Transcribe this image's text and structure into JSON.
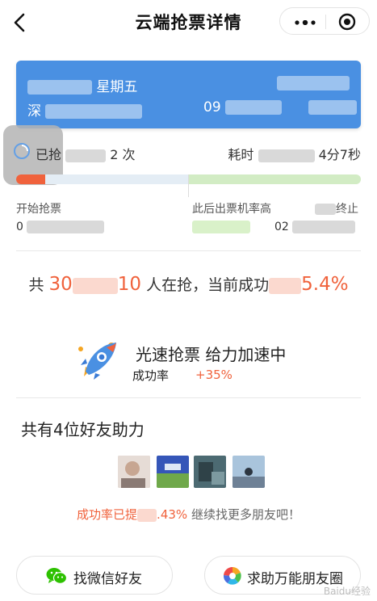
{
  "header": {
    "title": "云端抢票详情",
    "icons": {
      "back": "chevron-left-icon",
      "more": "more-dots-icon",
      "close": "record-circle-icon"
    }
  },
  "ticket": {
    "weekday": "星期五",
    "from_prefix": "深",
    "time_prefix": "09"
  },
  "stats": {
    "grab_prefix": "已抢",
    "grab_suffix": "2 次",
    "elapsed_prefix": "耗时",
    "elapsed_suffix": "4分7秒"
  },
  "progress": {
    "phase1_fraction": 0.5,
    "phase1_color": "#e4edf5",
    "phase2_color": "#d2ecc4",
    "done_color": "#f0623c"
  },
  "phases": {
    "start_label": "开始抢票",
    "start_time_prefix": "0",
    "peak_label": "此后出票机率高",
    "peak_time_prefix": "",
    "end_label": "终止",
    "end_time_prefix": "02"
  },
  "compete": {
    "prefix": "共",
    "count_head": "30",
    "count_tail": "10",
    "middle": "人在抢，当前成功",
    "rate_tail": "5.4%"
  },
  "speed": {
    "title": "光速抢票 给力加速中",
    "rate_label": "成功率",
    "rate_plus": "+35%",
    "icon": "rocket-icon"
  },
  "friends": {
    "title": "共有4位好友助力",
    "boost_prefix": "成功率已提",
    "boost_value": ".43%",
    "boost_suffix": "继续找更多朋友吧！"
  },
  "buttons": {
    "wechat": "找微信好友",
    "moments": "求助万能朋友圈"
  },
  "watermark": "Baidu经验"
}
